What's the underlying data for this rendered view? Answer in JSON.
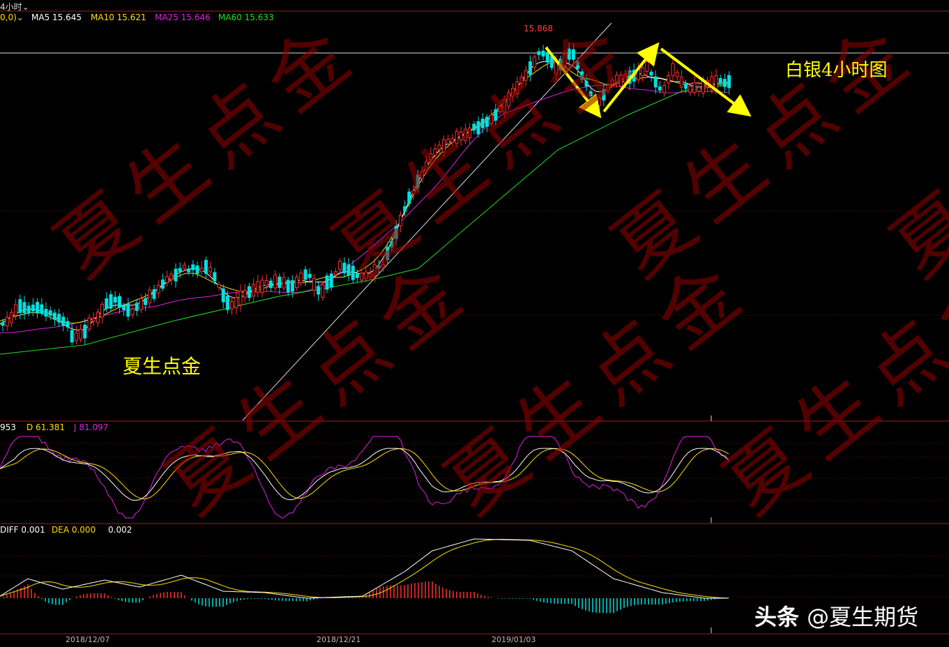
{
  "header": {
    "period": "4小时",
    "param_frag": "0,0)",
    "ma": [
      {
        "label": "MA5 15.645",
        "color": "#ffffff"
      },
      {
        "label": "MA10 15.621",
        "color": "#ffe000"
      },
      {
        "label": "MA25 15.646",
        "color": "#e020e0"
      },
      {
        "label": "MA60 15.633",
        "color": "#20e020"
      }
    ]
  },
  "kdj": {
    "k_frag": "953",
    "d_label": "D 61.381",
    "j_label": "J 81.097"
  },
  "macd": {
    "diff_label": "DIFF 0.001",
    "dea_label": "DEA 0.000",
    "macd_value": "0.002"
  },
  "annotations": {
    "high_price": "15.868",
    "title": "白银4小时图",
    "brand_left": "夏生点金",
    "watermark": "夏生点金",
    "footer_logo": "头条",
    "footer_account": "@夏生期货"
  },
  "x_dates": [
    "2018/12/07",
    "2018/12/21",
    "2019/01/03"
  ],
  "colors": {
    "up": "#ff3030",
    "down": "#00e0e0",
    "ma5": "#ffffff",
    "ma10": "#ffe000",
    "ma25": "#e020e0",
    "ma60": "#20e020",
    "arrow": "#ffff00"
  },
  "chart_data": [
    {
      "type": "candlestick",
      "title": "白银4小时图",
      "x_ticks": [
        "2018/12/07",
        "2018/12/21",
        "2019/01/03"
      ],
      "series": [
        {
          "name": "MA5",
          "last": 15.645
        },
        {
          "name": "MA10",
          "last": 15.621
        },
        {
          "name": "MA25",
          "last": 15.646
        },
        {
          "name": "MA60",
          "last": 15.633
        }
      ],
      "annotations": [
        {
          "text": "15.868",
          "kind": "high"
        }
      ]
    },
    {
      "type": "line",
      "series": [
        {
          "name": "D",
          "last": 61.381
        },
        {
          "name": "J",
          "last": 81.097
        }
      ]
    },
    {
      "type": "bar",
      "series": [
        {
          "name": "DIFF",
          "last": 0.001
        },
        {
          "name": "DEA",
          "last": 0.0
        }
      ]
    }
  ]
}
